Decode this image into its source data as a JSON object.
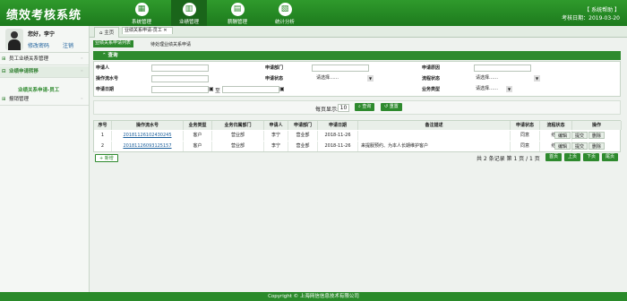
{
  "app": {
    "title": "绩效考核系统",
    "help": "【 系统帮助 】",
    "date_label": "考核日期：2019-03-20"
  },
  "nav": [
    {
      "label": "系统管理",
      "icon": "grid-icon"
    },
    {
      "label": "业绩管理",
      "icon": "chart-icon"
    },
    {
      "label": "薪酬管理",
      "icon": "wallet-icon"
    },
    {
      "label": "统计分析",
      "icon": "stats-icon"
    }
  ],
  "user": {
    "greeting": "您好，李宁",
    "change_pwd": "修改密码",
    "logout": "注销"
  },
  "menu": [
    "员工业绩关系管理",
    "业绩申请转移",
    "报销管理"
  ],
  "submenu": "业绩关系申请-员工",
  "tabs": [
    "主页",
    "业绩关系申请-员工 ✕"
  ],
  "subtabs": [
    "业绩关系申请列表",
    "待处理业绩关系申请"
  ],
  "panel": "查询",
  "form": {
    "applicant": "申请人",
    "dept": "申请部门",
    "reason": "申请原因",
    "flow_no": "操作流水号",
    "status": "申请状态",
    "flow_status": "流程状态",
    "date": "申请日期",
    "to": "至",
    "biz_type": "业务类型",
    "select": "请选择……"
  },
  "search": {
    "per_page": "每页显示:",
    "per_page_val": "10",
    "query": "查询",
    "reset": "重置"
  },
  "grid": {
    "headers": [
      "序号",
      "操作流水号",
      "业务类型",
      "业务归属部门",
      "申请人",
      "申请部门",
      "申请日期",
      "备注描述",
      "申请状态",
      "流程状态",
      "操作"
    ],
    "rows": [
      [
        "1",
        "20181126102430245",
        "客户",
        "营业部",
        "李宁",
        "营业部",
        "2018-11-26",
        "",
        "同意",
        "结束"
      ],
      [
        "2",
        "20181126093125157",
        "客户",
        "营业部",
        "李宁",
        "营业部",
        "2018-11-26",
        "来提服预约、为本人长期维护客户",
        "同意",
        "结束"
      ]
    ],
    "actions": [
      "编辑",
      "提交",
      "删除"
    ]
  },
  "add": "新增",
  "pager": {
    "info": "共 2 条记录  第 1 页 / 1 页",
    "first": "首页",
    "prev": "上页",
    "next": "下页",
    "last": "尾页"
  },
  "footer": "Copyright © 上海网信信息技术有限公司"
}
